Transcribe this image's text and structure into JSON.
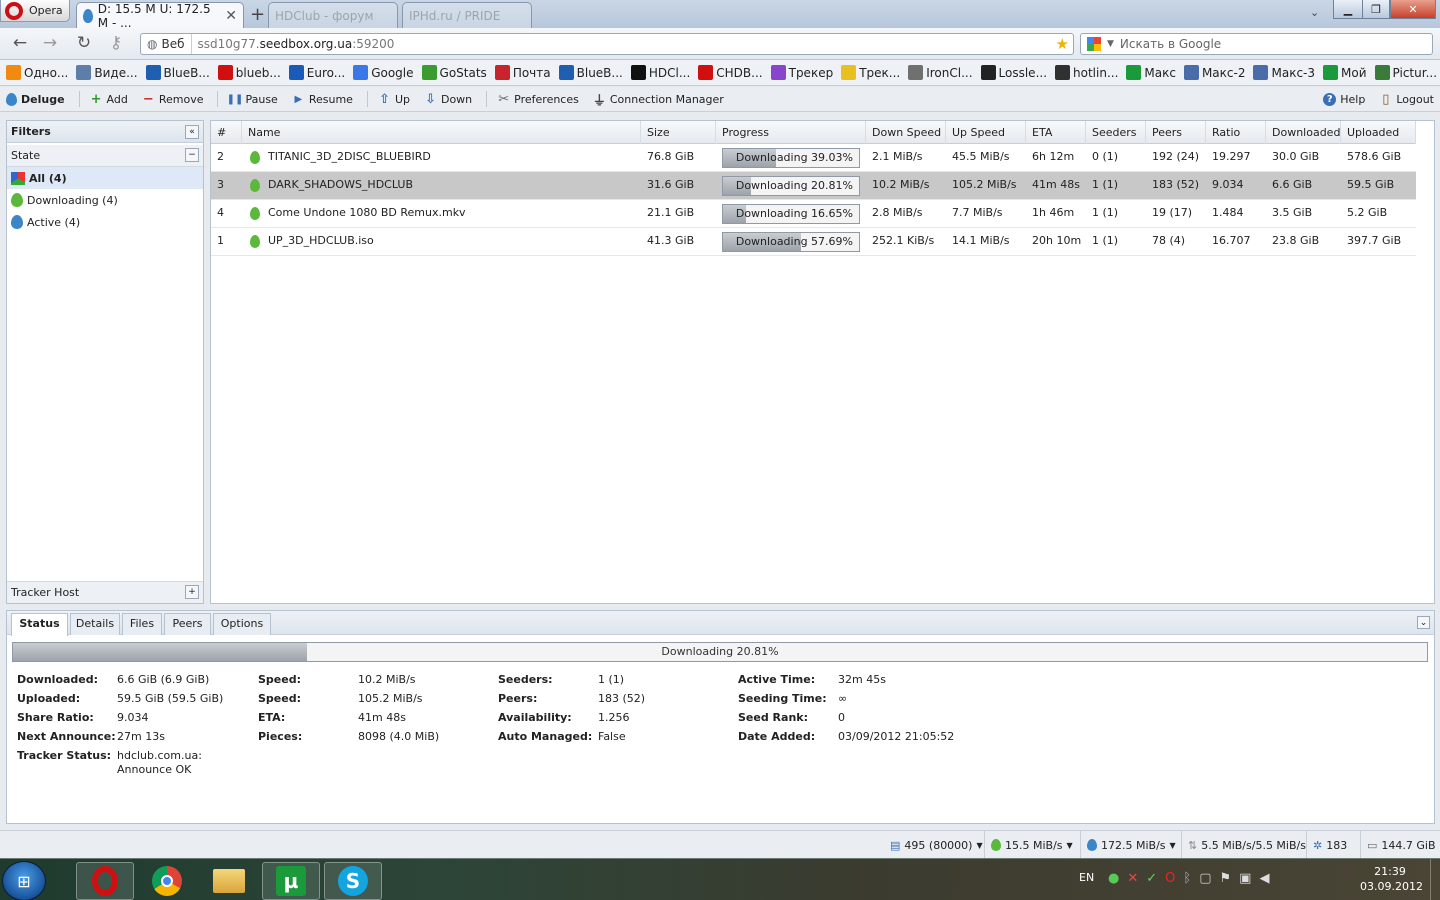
{
  "browser": {
    "opera_label": "Opera",
    "active_tab_title": "D: 15.5 M U: 172.5 M - ...",
    "inactive_tabs": [
      "HDClub - форум",
      "IPHd.ru / PRIDE"
    ],
    "address_badge": "Веб",
    "url_prefix": "ssd10g77.",
    "url_domain": "seedbox.org.ua",
    "url_suffix": ":59200",
    "search_placeholder": "Искать в Google"
  },
  "bookmarks": [
    {
      "label": "Одно...",
      "color": "#f08a10"
    },
    {
      "label": "Виде...",
      "color": "#5c7ea8"
    },
    {
      "label": "BlueB...",
      "color": "#1e5fb0"
    },
    {
      "label": "blueb...",
      "color": "#d01010"
    },
    {
      "label": "Euro...",
      "color": "#1a5ab8"
    },
    {
      "label": "Google",
      "color": "#3b78e7"
    },
    {
      "label": "GoStats",
      "color": "#3a9b2e"
    },
    {
      "label": "Почта",
      "color": "#c8242c"
    },
    {
      "label": "BlueB...",
      "color": "#1e5fb0"
    },
    {
      "label": "HDCl...",
      "color": "#111111"
    },
    {
      "label": "CHDB...",
      "color": "#d01010"
    },
    {
      "label": "Трекер",
      "color": "#8844cc"
    },
    {
      "label": "Трек...",
      "color": "#e8c020"
    },
    {
      "label": "IronCl...",
      "color": "#707070"
    },
    {
      "label": "Lossle...",
      "color": "#222222"
    },
    {
      "label": "hotlin...",
      "color": "#303030"
    },
    {
      "label": "Макс",
      "color": "#1a9a3a"
    },
    {
      "label": "Макс-2",
      "color": "#4a6ca8"
    },
    {
      "label": "Макс-3",
      "color": "#4a6ca8"
    },
    {
      "label": "Мой",
      "color": "#1a9a3a"
    },
    {
      "label": "Pictur...",
      "color": "#3a7a3a"
    }
  ],
  "toolbar": {
    "app_name": "Deluge",
    "add": "Add",
    "remove": "Remove",
    "pause": "Pause",
    "resume": "Resume",
    "up": "Up",
    "down": "Down",
    "preferences": "Preferences",
    "connection_manager": "Connection Manager",
    "help": "Help",
    "logout": "Logout"
  },
  "filters": {
    "title": "Filters",
    "state_header": "State",
    "items": [
      "All (4)",
      "Downloading (4)",
      "Active (4)"
    ],
    "tracker_header": "Tracker Host"
  },
  "grid": {
    "columns": [
      "#",
      "Name",
      "Size",
      "Progress",
      "Down Speed",
      "Up Speed",
      "ETA",
      "Seeders",
      "Peers",
      "Ratio",
      "Downloaded",
      "Uploaded"
    ],
    "rows": [
      {
        "num": "2",
        "name": "TITANIC_3D_2DISC_BLUEBIRD",
        "size": "76.8 GiB",
        "progress": 39.03,
        "progress_text": "Downloading 39.03%",
        "down": "2.1 MiB/s",
        "up": "45.5 MiB/s",
        "eta": "6h 12m",
        "seeders": "0 (1)",
        "peers": "192 (24)",
        "ratio": "19.297",
        "downloaded": "30.0 GiB",
        "uploaded": "578.6 GiB",
        "selected": false
      },
      {
        "num": "3",
        "name": "DARK_SHADOWS_HDCLUB",
        "size": "31.6 GiB",
        "progress": 20.81,
        "progress_text": "Downloading 20.81%",
        "down": "10.2 MiB/s",
        "up": "105.2 MiB/s",
        "eta": "41m 48s",
        "seeders": "1 (1)",
        "peers": "183 (52)",
        "ratio": "9.034",
        "downloaded": "6.6 GiB",
        "uploaded": "59.5 GiB",
        "selected": true
      },
      {
        "num": "4",
        "name": "Come Undone 1080 BD Remux.mkv",
        "size": "21.1 GiB",
        "progress": 16.65,
        "progress_text": "Downloading 16.65%",
        "down": "2.8 MiB/s",
        "up": "7.7 MiB/s",
        "eta": "1h 46m",
        "seeders": "1 (1)",
        "peers": "19 (17)",
        "ratio": "1.484",
        "downloaded": "3.5 GiB",
        "uploaded": "5.2 GiB",
        "selected": false
      },
      {
        "num": "1",
        "name": "UP_3D_HDCLUB.iso",
        "size": "41.3 GiB",
        "progress": 57.69,
        "progress_text": "Downloading 57.69%",
        "down": "252.1 KiB/s",
        "up": "14.1 MiB/s",
        "eta": "20h 10m",
        "seeders": "1 (1)",
        "peers": "78 (4)",
        "ratio": "16.707",
        "downloaded": "23.8 GiB",
        "uploaded": "397.7 GiB",
        "selected": false
      }
    ]
  },
  "details": {
    "tabs": [
      "Status",
      "Details",
      "Files",
      "Peers",
      "Options"
    ],
    "progress": 20.81,
    "progress_text": "Downloading 20.81%",
    "col1": [
      {
        "label": "Downloaded:",
        "value": "6.6 GiB (6.9 GiB)"
      },
      {
        "label": "Uploaded:",
        "value": "59.5 GiB (59.5 GiB)"
      },
      {
        "label": "Share Ratio:",
        "value": "9.034"
      },
      {
        "label": "Next Announce:",
        "value": "27m 13s"
      },
      {
        "label": "Tracker Status:",
        "value": "hdclub.com.ua: Announce OK"
      }
    ],
    "col2": [
      {
        "label": "Speed:",
        "value": "10.2 MiB/s"
      },
      {
        "label": "Speed:",
        "value": "105.2 MiB/s"
      },
      {
        "label": "ETA:",
        "value": "41m 48s"
      },
      {
        "label": "Pieces:",
        "value": "8098 (4.0 MiB)"
      }
    ],
    "col3": [
      {
        "label": "Seeders:",
        "value": "1 (1)"
      },
      {
        "label": "Peers:",
        "value": "183 (52)"
      },
      {
        "label": "Availability:",
        "value": "1.256"
      },
      {
        "label": "Auto Managed:",
        "value": "False"
      }
    ],
    "col4": [
      {
        "label": "Active Time:",
        "value": "32m 45s"
      },
      {
        "label": "Seeding Time:",
        "value": "∞"
      },
      {
        "label": "Seed Rank:",
        "value": "0"
      },
      {
        "label": "Date Added:",
        "value": "03/09/2012 21:05:52"
      }
    ]
  },
  "statusbar": {
    "connections": "495 (80000)",
    "down_speed": "15.5 MiB/s",
    "up_speed": "172.5 MiB/s",
    "protocol": "5.5 MiB/s/5.5 MiB/s",
    "dht": "183",
    "free_space": "144.7 GiB"
  },
  "taskbar": {
    "lang": "EN",
    "time": "21:39",
    "date": "03.09.2012"
  }
}
